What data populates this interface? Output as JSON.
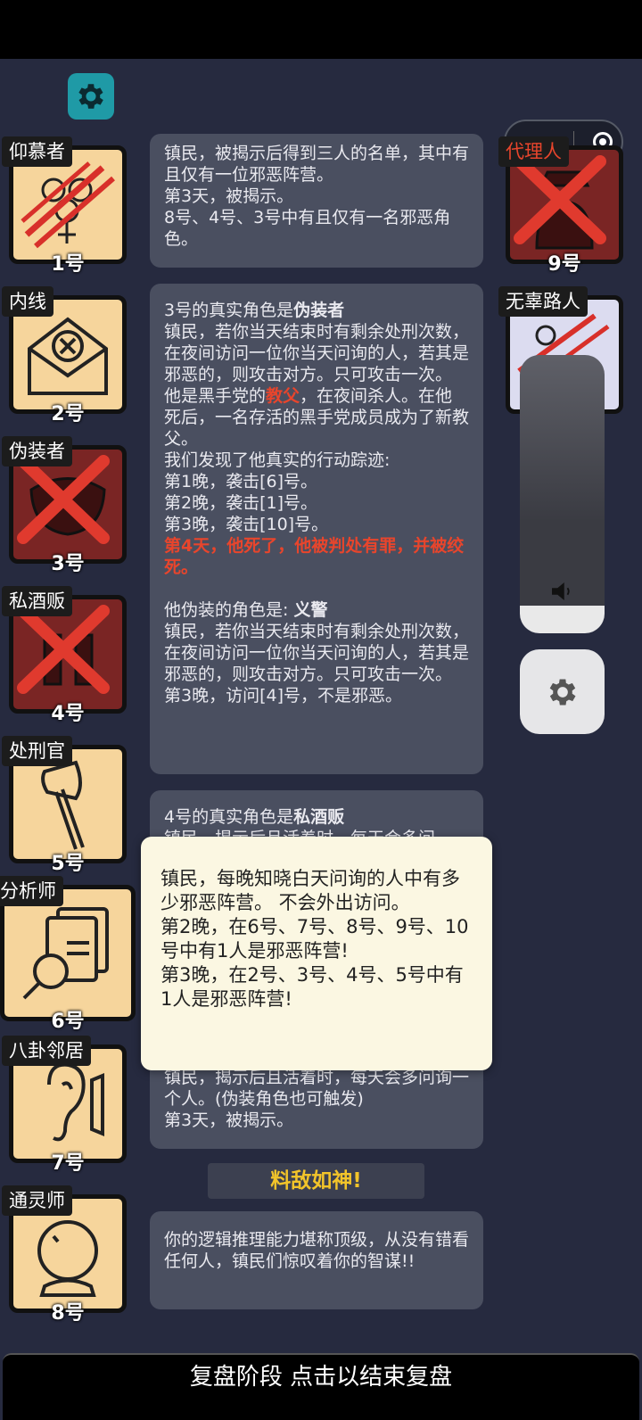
{
  "bottom_bar": "复盘阶段 点击以结束复盘",
  "banner": "料敌如神!",
  "cards_left": [
    {
      "label": "仰慕者",
      "num": "1号",
      "icon": "bouquet-icon",
      "dead": false,
      "clawed": true
    },
    {
      "label": "内线",
      "num": "2号",
      "icon": "envelope-icon",
      "dead": false,
      "clawed": false
    },
    {
      "label": "伪装者",
      "num": "3号",
      "icon": "mask-icon",
      "dead": true,
      "clawed": false
    },
    {
      "label": "私酒贩",
      "num": "4号",
      "icon": "bottles-icon",
      "dead": true,
      "clawed": false
    },
    {
      "label": "处刑官",
      "num": "5号",
      "icon": "axe-icon",
      "dead": false,
      "clawed": false
    },
    {
      "label": "分析师",
      "num": "6号",
      "icon": "document-search-icon",
      "dead": false,
      "clawed": false
    },
    {
      "label": "八卦邻居",
      "num": "7号",
      "icon": "ear-icon",
      "dead": false,
      "clawed": false
    },
    {
      "label": "通灵师",
      "num": "8号",
      "icon": "crystal-ball-icon",
      "dead": false,
      "clawed": false
    }
  ],
  "cards_right": [
    {
      "label": "代理人",
      "num": "9号",
      "icon": "agent-icon",
      "dead": true
    },
    {
      "label": "无辜路人",
      "num": "",
      "icon": "bystander-icon",
      "dead": false
    }
  ],
  "panel1": [
    "镇民，被揭示后得到三人的名单，其中有且仅有一位邪恶阵营。",
    "第3天，被揭示。",
    "8号、4号、3号中有且仅有一名邪恶角色。"
  ],
  "panel2": {
    "head_pre": "3号的真实角色是",
    "head_role": "伪装者",
    "desc": "镇民，若你当天结束时有剩余处刑次数，在夜间访问一位你当天问询的人，若其是邪恶的，则攻击对方。只可攻击一次。",
    "p1": "他是黑手党的",
    "p1_role": "教父",
    "p1_rest": "，在夜间杀人。在他死后，一名存活的黑手党成员成为了新教父。",
    "trace": "我们发现了他真实的行动踪迹:",
    "n1": "第1晚，袭击[6]号。",
    "n2": "第2晚，袭击[1]号。",
    "n3": "第3晚，袭击[10]号。",
    "death": "第4天，他死了，他被判处有罪，并被绞死。",
    "fake_pre": "他伪装的角色是:",
    "fake_role": "义警",
    "fake_desc": "镇民，若你当天结束时有剩余处刑次数，在夜间访问一位你当天问询的人，若其是邪恶的，则攻击对方。只可攻击一次。",
    "fake_n3": "第3晚，访问[4]号，不是邪恶。"
  },
  "panel3": {
    "head_pre": "4号的真实角色是",
    "head_role": "私酒贩",
    "partial": "镇民，揭示后且活着时，每天会多问"
  },
  "panel4": [
    "镇民，揭示后且活着时，每天会多问询一个人。(伪装角色也可触发)",
    "第3天，被揭示。"
  ],
  "panel5": "你的逻辑推理能力堪称顶级，从没有错看任何人，镇民们惊叹着你的智谋!!",
  "popup": [
    "镇民，每晚知晓白天问询的人中有多少邪恶阵营。 不会外出访问。",
    "第2晚，在6号、7号、8号、9号、10号中有1人是邪恶阵营!",
    "第3晚，在2号、3号、4号、5号中有1人是邪恶阵营!"
  ],
  "colors": {
    "accent_red": "#e8452c",
    "gold": "#f2c42a",
    "teal": "#1f9aa6",
    "card_bg": "#f6d59c"
  }
}
